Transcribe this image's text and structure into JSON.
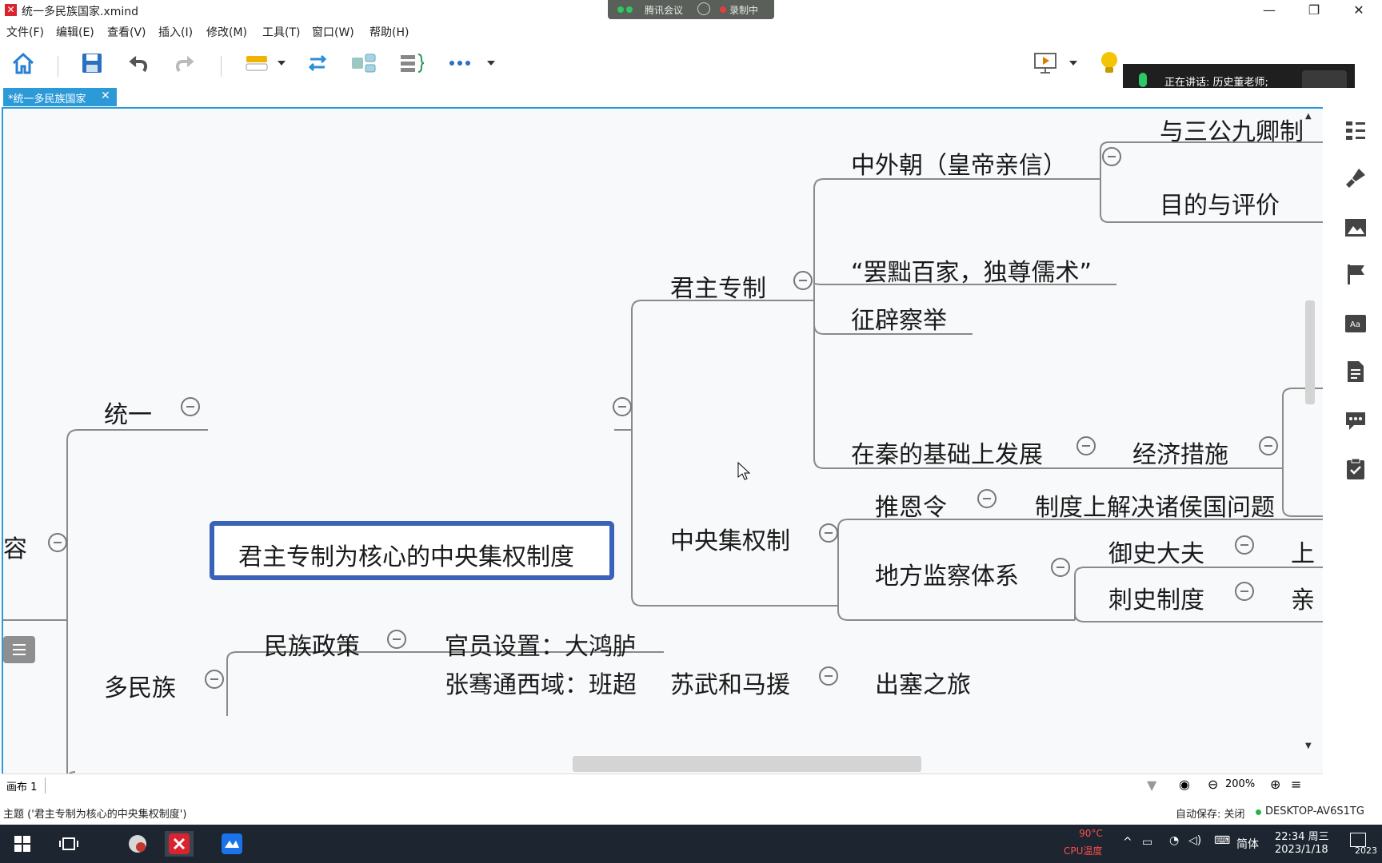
{
  "window": {
    "title": "统一多民族国家.xmind",
    "meeting": {
      "app": "腾讯会议",
      "recording": "录制中"
    },
    "speaking": "正在讲话: 历史董老师;"
  },
  "menu": [
    "文件(F)",
    "编辑(E)",
    "查看(V)",
    "插入(I)",
    "修改(M)",
    "工具(T)",
    "窗口(W)",
    "帮助(H)"
  ],
  "toolbar": {
    "icons": [
      "home-icon",
      "save-icon",
      "undo-icon",
      "redo-icon",
      "topic-style-icon",
      "relationship-icon",
      "subtopic-icon",
      "boundary-icon",
      "more-icon",
      "presentation-icon",
      "idea-icon"
    ]
  },
  "tab": {
    "label": "*统一多民族国家",
    "close": "✕"
  },
  "mindmap": {
    "central": "君主专制为核心的中央集权制度",
    "nodes": {
      "n_tongyi": "统一",
      "n_rong": "容",
      "n_duominzu": "多民族",
      "n_junzhu": "君主专制",
      "n_zhongyang": "中央集权制",
      "n_zhongwaichao": "中外朝（皇帝亲信）",
      "n_sangong": "与三公九卿制",
      "n_mudi": "目的与评价",
      "n_bachu": "“罢黜百家，独尊儒术”",
      "n_zhengpi": "征辟察举",
      "n_zaiqin": "在秦的基础上发展",
      "n_jingji": "经济措施",
      "n_tuien": "推恩令",
      "n_zhidu": "制度上解决诸侯国问题",
      "n_difang": "地方监察体系",
      "n_yushi": "御史大夫",
      "n_yushi_child": "上",
      "n_cishi": "刺史制度",
      "n_cishi_child": "亲",
      "n_minzu": "民族政策",
      "n_guanyuan": "官员设置：大鸿胪",
      "n_zhangqian": "张骞通西域：班超",
      "n_suwu": "苏武和马援",
      "n_zhaorong": "出塞之旅"
    }
  },
  "sheet": {
    "label": "画布 1",
    "zoom": "200%"
  },
  "status": {
    "topic": "主题 ('君主专制为核心的中央集权制度')",
    "autosave": "自动保存: 关闭",
    "host": "DESKTOP-AV6S1TG"
  },
  "taskbar": {
    "cpu_temp": "90°C",
    "cpu_label": "CPU温度",
    "ime": "简体",
    "time": "22:34 周三",
    "date": "2023/1/18",
    "corner": "2023"
  },
  "colors": {
    "accent": "#2d9ad8",
    "central_border": "#3a62b8",
    "branch": "#8a8a8a"
  }
}
